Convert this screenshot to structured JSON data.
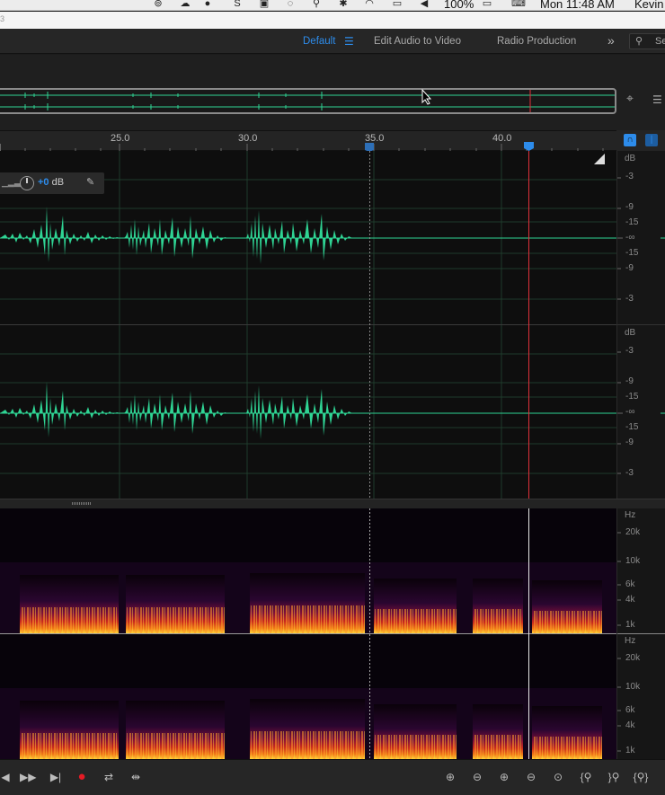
{
  "menubar": {
    "battery": "100%",
    "clock": "Mon 11:48 AM",
    "user": "Kevin",
    "status_icons": [
      "creative-cloud-icon",
      "cloud-icon",
      "tags-icon",
      "app-icon",
      "app-icon",
      "sync-icon",
      "search-icon",
      "bluetooth-icon",
      "wifi-icon",
      "airplay-icon",
      "volume-icon",
      "battery-icon",
      "keyboard-icon"
    ]
  },
  "workspace": {
    "active": "Default",
    "items": [
      "Default",
      "Edit Audio to Video",
      "Radio Production"
    ],
    "search_placeholder": "Se"
  },
  "ruler": {
    "labels": [
      "25.0",
      "30.0",
      "35.0",
      "40.0"
    ]
  },
  "clip_hud": {
    "volume_value": "+0",
    "volume_unit": "dB"
  },
  "db_scale": {
    "unit": "dB",
    "labels": [
      "-3",
      "-9",
      "-15",
      "-∞",
      "-15",
      "-9",
      "-3"
    ]
  },
  "spectral_scale": {
    "unit": "Hz",
    "labels": [
      "20k",
      "10k",
      "6k",
      "4k",
      "1k"
    ]
  },
  "colors": {
    "waveform": "#2fd494",
    "accent": "#2d8ceb",
    "playhead": "#e0303a",
    "record": "#e51b25"
  },
  "transport": {
    "buttons": [
      "skip-back-icon",
      "fast-forward-icon",
      "skip-forward-icon",
      "record-icon",
      "loop-icon",
      "skip-selection-icon"
    ],
    "zoom_buttons": [
      "zoom-in-amplitude-icon",
      "zoom-out-amplitude-icon",
      "zoom-in-time-icon",
      "zoom-out-time-icon",
      "zoom-full-icon",
      "zoom-in-left-icon",
      "zoom-in-right-icon",
      "zoom-selection-icon"
    ]
  }
}
